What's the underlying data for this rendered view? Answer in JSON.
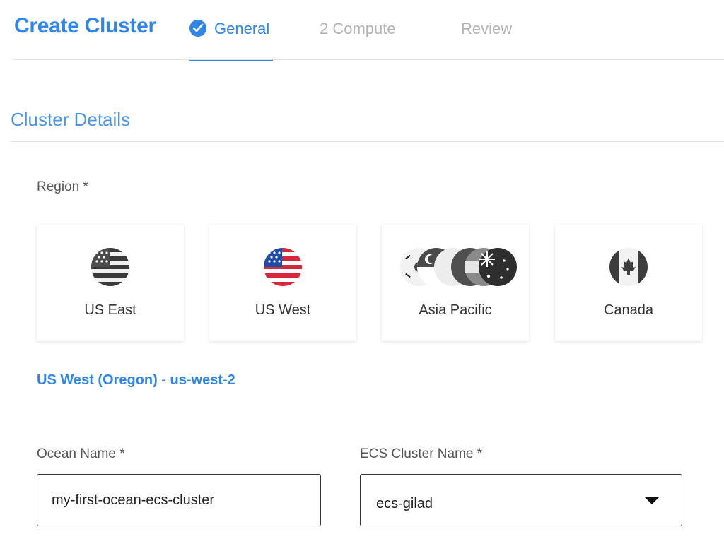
{
  "header": {
    "title": "Create Cluster",
    "steps": [
      {
        "label": "General",
        "state": "complete"
      },
      {
        "label": "2 Compute",
        "state": "pending"
      },
      {
        "label": "Review",
        "state": "pending"
      }
    ]
  },
  "section": {
    "title": "Cluster Details"
  },
  "region": {
    "label": "Region *",
    "options": [
      {
        "name": "US East",
        "icon": "us-flag-grayscale-icon"
      },
      {
        "name": "US West",
        "icon": "us-flag-color-icon"
      },
      {
        "name": "Asia Pacific",
        "icon": "asia-pacific-flags-icon"
      },
      {
        "name": "Canada",
        "icon": "canada-flag-icon"
      }
    ],
    "selected": "US West (Oregon) - us-west-2"
  },
  "form": {
    "ocean_name": {
      "label": "Ocean Name *",
      "value": "my-first-ocean-ecs-cluster"
    },
    "ecs_cluster_name": {
      "label": "ECS Cluster Name *",
      "value": "ecs-gilad"
    }
  },
  "colors": {
    "accent": "#2f86e8",
    "muted": "#b3b3b3"
  }
}
